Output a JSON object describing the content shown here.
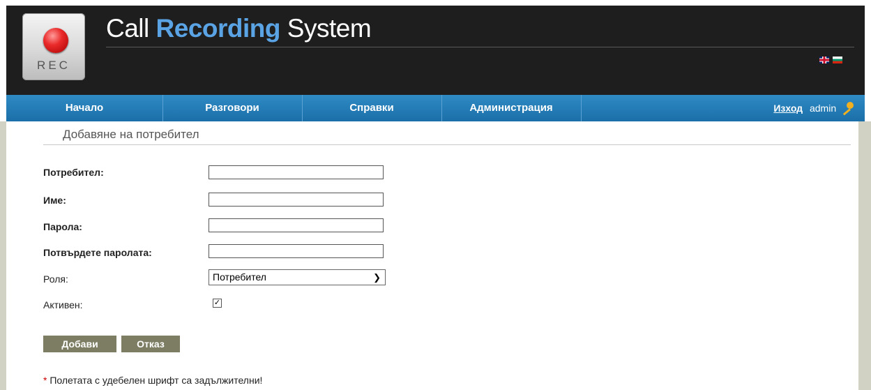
{
  "brand": {
    "logo_text": "REC",
    "title_part1": "Call",
    "title_accent": "Recording",
    "title_part2": "System"
  },
  "languages": [
    {
      "code": "en",
      "icon": "uk-flag-icon"
    },
    {
      "code": "bg",
      "icon": "bg-flag-icon"
    }
  ],
  "nav": {
    "items": [
      "Начало",
      "Разговори",
      "Справки",
      "Администрация"
    ],
    "logout": "Изход",
    "user": "admin",
    "user_icon": "key-icon"
  },
  "page": {
    "title": "Добавяне на потребител"
  },
  "form": {
    "username": {
      "label": "Потребител:",
      "value": ""
    },
    "name": {
      "label": "Име:",
      "value": ""
    },
    "password": {
      "label": "Парола:",
      "value": ""
    },
    "confirm": {
      "label": "Потвърдете паролата:",
      "value": ""
    },
    "role": {
      "label": "Роля:",
      "value": "Потребител"
    },
    "active": {
      "label": "Активен:",
      "checked": true,
      "mark": "✓"
    }
  },
  "buttons": {
    "add": "Добави",
    "cancel": "Отказ"
  },
  "footnote": {
    "star": "*",
    "text": " Полетата с удебелен шрифт са задължителни!"
  },
  "colors": {
    "header_bg": "#1e1e1e",
    "nav_bg": "#2480bd",
    "accent": "#5aa4e6",
    "button_bg": "#7d7d63",
    "side_bg": "#d2d2c4"
  }
}
